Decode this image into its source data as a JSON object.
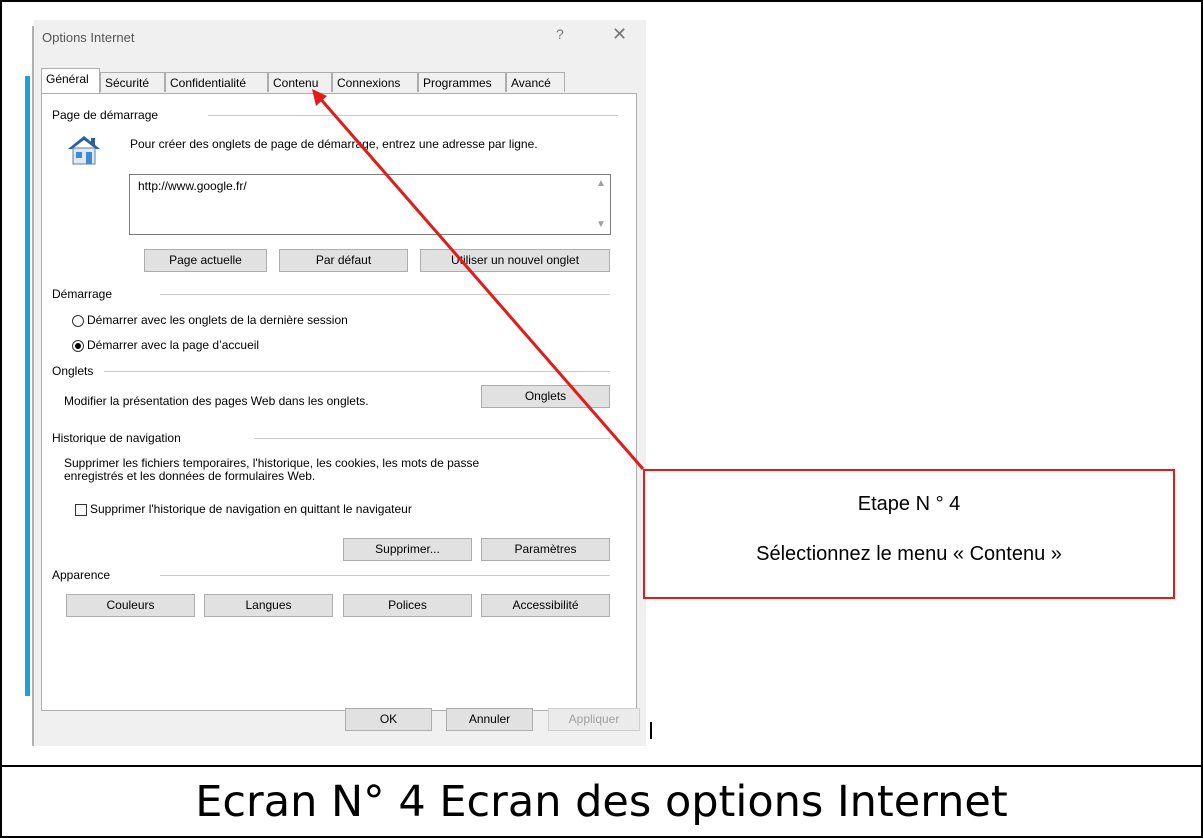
{
  "dialog": {
    "title": "Options Internet",
    "help_label": "?",
    "close_label": "✕"
  },
  "tabs": [
    {
      "label": "Général",
      "active": true
    },
    {
      "label": "Sécurité",
      "active": false
    },
    {
      "label": "Confidentialité",
      "active": false
    },
    {
      "label": "Contenu",
      "active": false
    },
    {
      "label": "Connexions",
      "active": false
    },
    {
      "label": "Programmes",
      "active": false
    },
    {
      "label": "Avancé",
      "active": false
    }
  ],
  "home_page": {
    "group_label": "Page de démarrage",
    "description": "Pour créer des onglets de page de démarrage, entrez une adresse par ligne.",
    "url_value": "http://www.google.fr/",
    "buttons": {
      "current": "Page actuelle",
      "default": "Par défaut",
      "new_tab": "Utiliser un nouvel onglet"
    }
  },
  "startup": {
    "group_label": "Démarrage",
    "options": [
      {
        "label": "Démarrer avec les onglets de la dernière session",
        "checked": false
      },
      {
        "label": "Démarrer avec la page d’accueil",
        "checked": true
      }
    ]
  },
  "tabs_group": {
    "group_label": "Onglets",
    "description": "Modifier la présentation des pages Web dans les onglets.",
    "button": "Onglets"
  },
  "history": {
    "group_label": "Historique de navigation",
    "description_line1": "Supprimer les fichiers temporaires, l'historique, les cookies, les mots de passe",
    "description_line2": "enregistrés et les données de formulaires Web.",
    "checkbox_label": "Supprimer l'historique de navigation en quittant le navigateur",
    "delete_button": "Supprimer...",
    "settings_button": "Paramètres"
  },
  "appearance": {
    "group_label": "Apparence",
    "buttons": {
      "colors": "Couleurs",
      "languages": "Langues",
      "fonts": "Polices",
      "accessibility": "Accessibilité"
    }
  },
  "footer_buttons": {
    "ok": "OK",
    "cancel": "Annuler",
    "apply": "Appliquer"
  },
  "annotation": {
    "step": "Etape N ° 4",
    "instruction": "Sélectionnez le menu « Contenu »",
    "color": "#e21b1b"
  },
  "caption": "Ecran N° 4 Ecran des options Internet"
}
